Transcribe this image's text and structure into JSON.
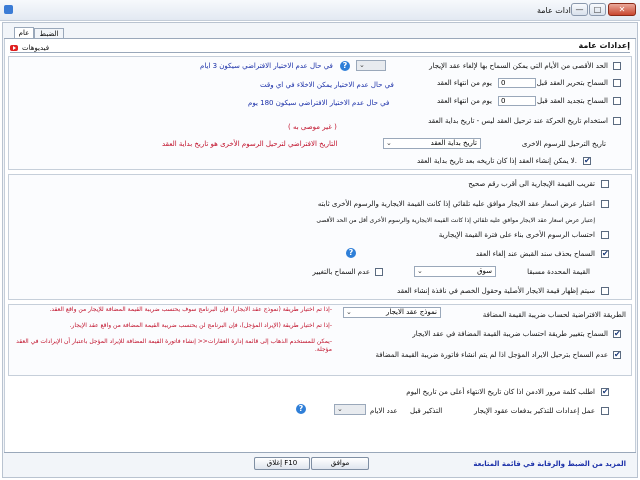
{
  "window": {
    "title": "إعدادات عامة",
    "icon": "app-icon"
  },
  "tabs": [
    {
      "label": "الضبط"
    },
    {
      "label": "عام"
    }
  ],
  "videos": {
    "label": "فيديوهات",
    "icon": "youtube-icon"
  },
  "section": {
    "title": "إعدادات عامة"
  },
  "s1": {
    "max_days_label": "الحد الأقصى من الأيام التي يمكن السماح بها لإلغاء عقد الإيجار",
    "max_days_note": "في حال عدم الاختيار الافتراضي سيكون 3 ايام",
    "release_label": "السماح بتحرير العقد قبل",
    "release_value": "0",
    "release_unit": "يوم من انتهاء العقد",
    "release_note": "في حال عدم الاختيار يمكن الاخلاء في اي وقت",
    "renew_label": "السماح بتجديد العقد قبل",
    "renew_value": "0",
    "renew_unit": "يوم من انتهاء العقد",
    "renew_note": "في حال عدم الاختيار الافتراضي سيكون 180 يوم",
    "movement_label": "استخدام تاريخ الحركة عند ترحيل العقد ليس - تاريخ بداية العقد",
    "not_recommended": "( غير موصى به )",
    "posting_date_label": "تاريخ الترحيل للرسوم الاخرى",
    "posting_date_value": "تاريخ بداية العقد",
    "posting_date_note": "التاريخ الافتراضي لترحيل الرسوم الأخرى هو تاريخ بداية العقد",
    "no_create_label": "لا يمكن إنشاء العقد إذا كان تاريخه بعد تاريخ بداية العقد."
  },
  "s2": {
    "round_label": "تقريب القيمة الإيجارية الى أقرب رقم صحيح",
    "rent_approved_label": "اعتبار عرض اسعار عقد الايجار موافق عليه تلقائي  إذا كانت القيمة الايجارية والرسوم الأخرى ثابته",
    "rent_approved_note": "إعتبار عرض اسعار عقد الايجار موافق عليه تلقائي  إذا كانت القيمة الايجارية والرسوم الأخرى أقل من الحد الأقصى",
    "other_fees_label": "احتساب الرسوم الأخرى بناء على فترة القيمة الإيجارية",
    "delete_receipt_label": "السماح بحذف سند القبض عند إلغاء العقد",
    "preset_value_label": "القيمة المحددة مسبقا",
    "preset_value_select": "سوق",
    "no_change_label": "عدم السماح بالتغيير",
    "show_original_label": "سيتم إظهار قيمة الايجار الأصلية وحقول الخصم في نافذة إنشاء العقد"
  },
  "s3": {
    "vat_method_label": "الطريقة  الافتراضية لحساب ضريبة القيمة المضافة",
    "vat_method_value": "نموذج عقد الايجار",
    "change_method_label": "السماح بتغيير طريقة احتساب ضريبة القيمة المضافة في عقد الايجار",
    "no_posting_label": "عدم السماح بترحيل الايراد المؤجل اذا لم يتم انشاء فاتورة ضريبة القيمة المضافة",
    "note1": "-إذا تم اختيار طريقة (نموذج عقد الايجار)، فإن البرنامج سوف يحتسب ضريبة القيمة المضافة للإيجار من  واقع العقد.",
    "note2": "-إذا تم اختيار طريقة (الإيراد المؤجل)، فإن البرنامج لن يحتسب ضريبة القيمة المضافة من واقع عقد الإيجار.",
    "note3": "-يمكن للمستخدم الذهاب إلى قائمة إدارة العقارات<< إنشاء فاتورة القيمة المضافة للإيراد المؤجل باعتبار  أن الإيرادات في العقد مؤجلة."
  },
  "s4": {
    "password_label": "اطلب كلمة مرور الادمن اذا كان تاريخ الانتهاء أعلى من تاريخ اليوم",
    "reminder_label": "عمل إعدادات للتذكير بدفعات عقود الإيجار",
    "remind_before": "التذكير قبل",
    "days_count": "عدد الايام"
  },
  "footer": {
    "ok": "موافق",
    "close": "إغلاق F10",
    "more_link": "المزيد من الضبط والرقابة في قائمة المتابعة"
  }
}
